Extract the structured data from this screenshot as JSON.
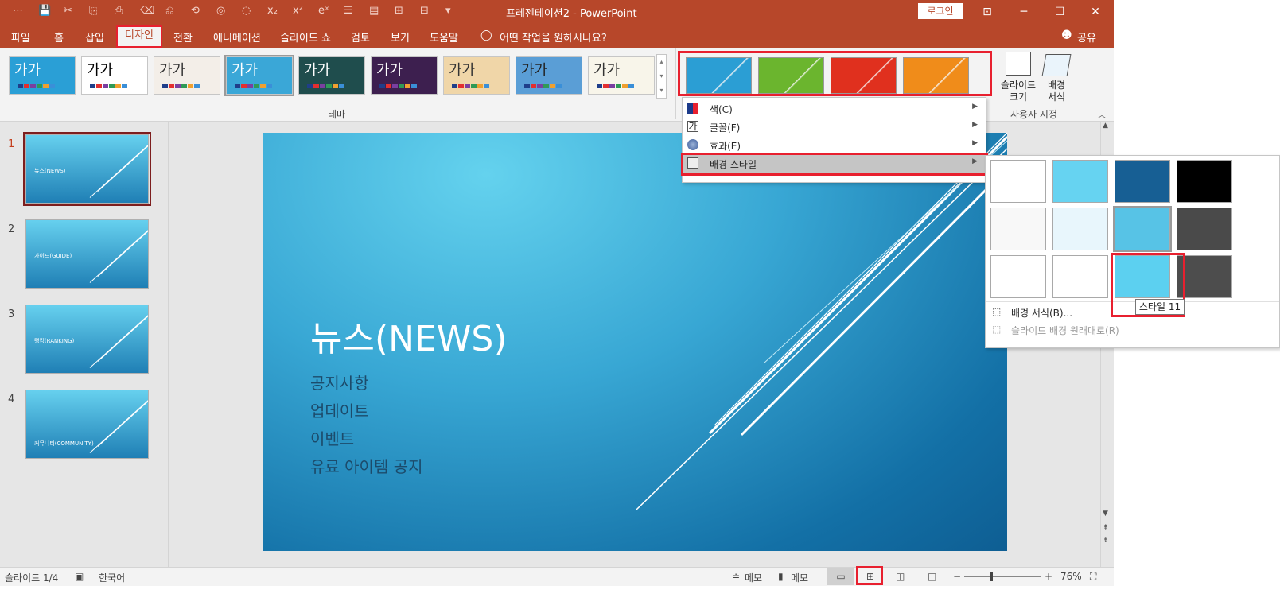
{
  "titlebar": {
    "quick_access": [
      "⋯",
      "💾",
      "✂",
      "⎘",
      "⎙",
      "⌫",
      "⎌",
      "⟲",
      "◎",
      "◌",
      "x₂",
      "x²",
      "eˣ",
      "☰",
      "▤",
      "⊞",
      "⊟",
      "▾"
    ],
    "title": "프레젠테이션2  -  PowerPoint",
    "login": "로그인",
    "controls": [
      "⊡",
      "─",
      "☐",
      "✕"
    ]
  },
  "tabs": [
    "파일",
    "홈",
    "삽입",
    "디자인",
    "전환",
    "애니메이션",
    "슬라이드 쇼",
    "검토",
    "보기",
    "도움말"
  ],
  "tell_me": "어떤 작업을 원하시나요?",
  "share": "공유",
  "ribbon": {
    "themes": [
      {
        "text": "가가",
        "bg": "#2a9fd6",
        "fg": "#ffffff"
      },
      {
        "text": "가가",
        "bg": "#ffffff",
        "fg": "#000000"
      },
      {
        "text": "가가",
        "bg": "#f3eee8",
        "fg": "#333333"
      },
      {
        "text": "가가",
        "bg": "#3aa7d7",
        "fg": "#ffffff"
      },
      {
        "text": "가가",
        "bg": "#1f4d4d",
        "fg": "#ffffff"
      },
      {
        "text": "가가",
        "bg": "#3d1f4f",
        "fg": "#ffffff"
      },
      {
        "text": "가가",
        "bg": "#f0d6a8",
        "fg": "#333333"
      },
      {
        "text": "가가",
        "bg": "#5a9ed6",
        "fg": "#222222"
      },
      {
        "text": "가가",
        "bg": "#f8f5ea",
        "fg": "#333333"
      }
    ],
    "theme_label": "테마",
    "variants": [
      {
        "color": "#2b9ed4"
      },
      {
        "color": "#6bb52e"
      },
      {
        "color": "#e0301e"
      },
      {
        "color": "#f08c1a"
      }
    ],
    "slide_size": "슬라이드\n크기",
    "format_bg": "배경\n서식",
    "custom_label": "사용자 지정"
  },
  "slides": [
    {
      "num": "1",
      "title": "뉴스(NEWS)"
    },
    {
      "num": "2",
      "title": "가이드(GUIDE)"
    },
    {
      "num": "3",
      "title": "랭킹(RANKING)"
    },
    {
      "num": "4",
      "title": "커뮤니티(COMMUNITY)"
    }
  ],
  "slide": {
    "title": "뉴스(NEWS)",
    "bullets": [
      "공지사항",
      "업데이트",
      "이벤트",
      "유료 아이템 공지"
    ]
  },
  "menu": {
    "items": [
      {
        "label": "색(C)",
        "icon": "color-palette-icon"
      },
      {
        "label": "글꼴(F)",
        "icon": "font-icon"
      },
      {
        "label": "효과(E)",
        "icon": "effects-icon"
      },
      {
        "label": "배경 스타일",
        "icon": "background-style-icon"
      }
    ]
  },
  "submenu": {
    "swatches": [
      [
        "#ffffff",
        "#66d3f1",
        "#175f94",
        "#000000"
      ],
      [
        "#f8f8f8",
        "#e8f6fc",
        "#57c3e6",
        "#4a4a4a"
      ],
      [
        "#ffffff",
        "#ffffff",
        "#5cd0f0",
        "#4d4d4d"
      ]
    ],
    "format_bg": "배경 서식(B)...",
    "reset_bg": "슬라이드 배경 원래대로(R)",
    "tooltip": "스타일 11"
  },
  "status": {
    "slide_count": "슬라이드 1/4",
    "language": "한국어",
    "notes": "메모",
    "comments": "메모",
    "zoom": "76%"
  }
}
